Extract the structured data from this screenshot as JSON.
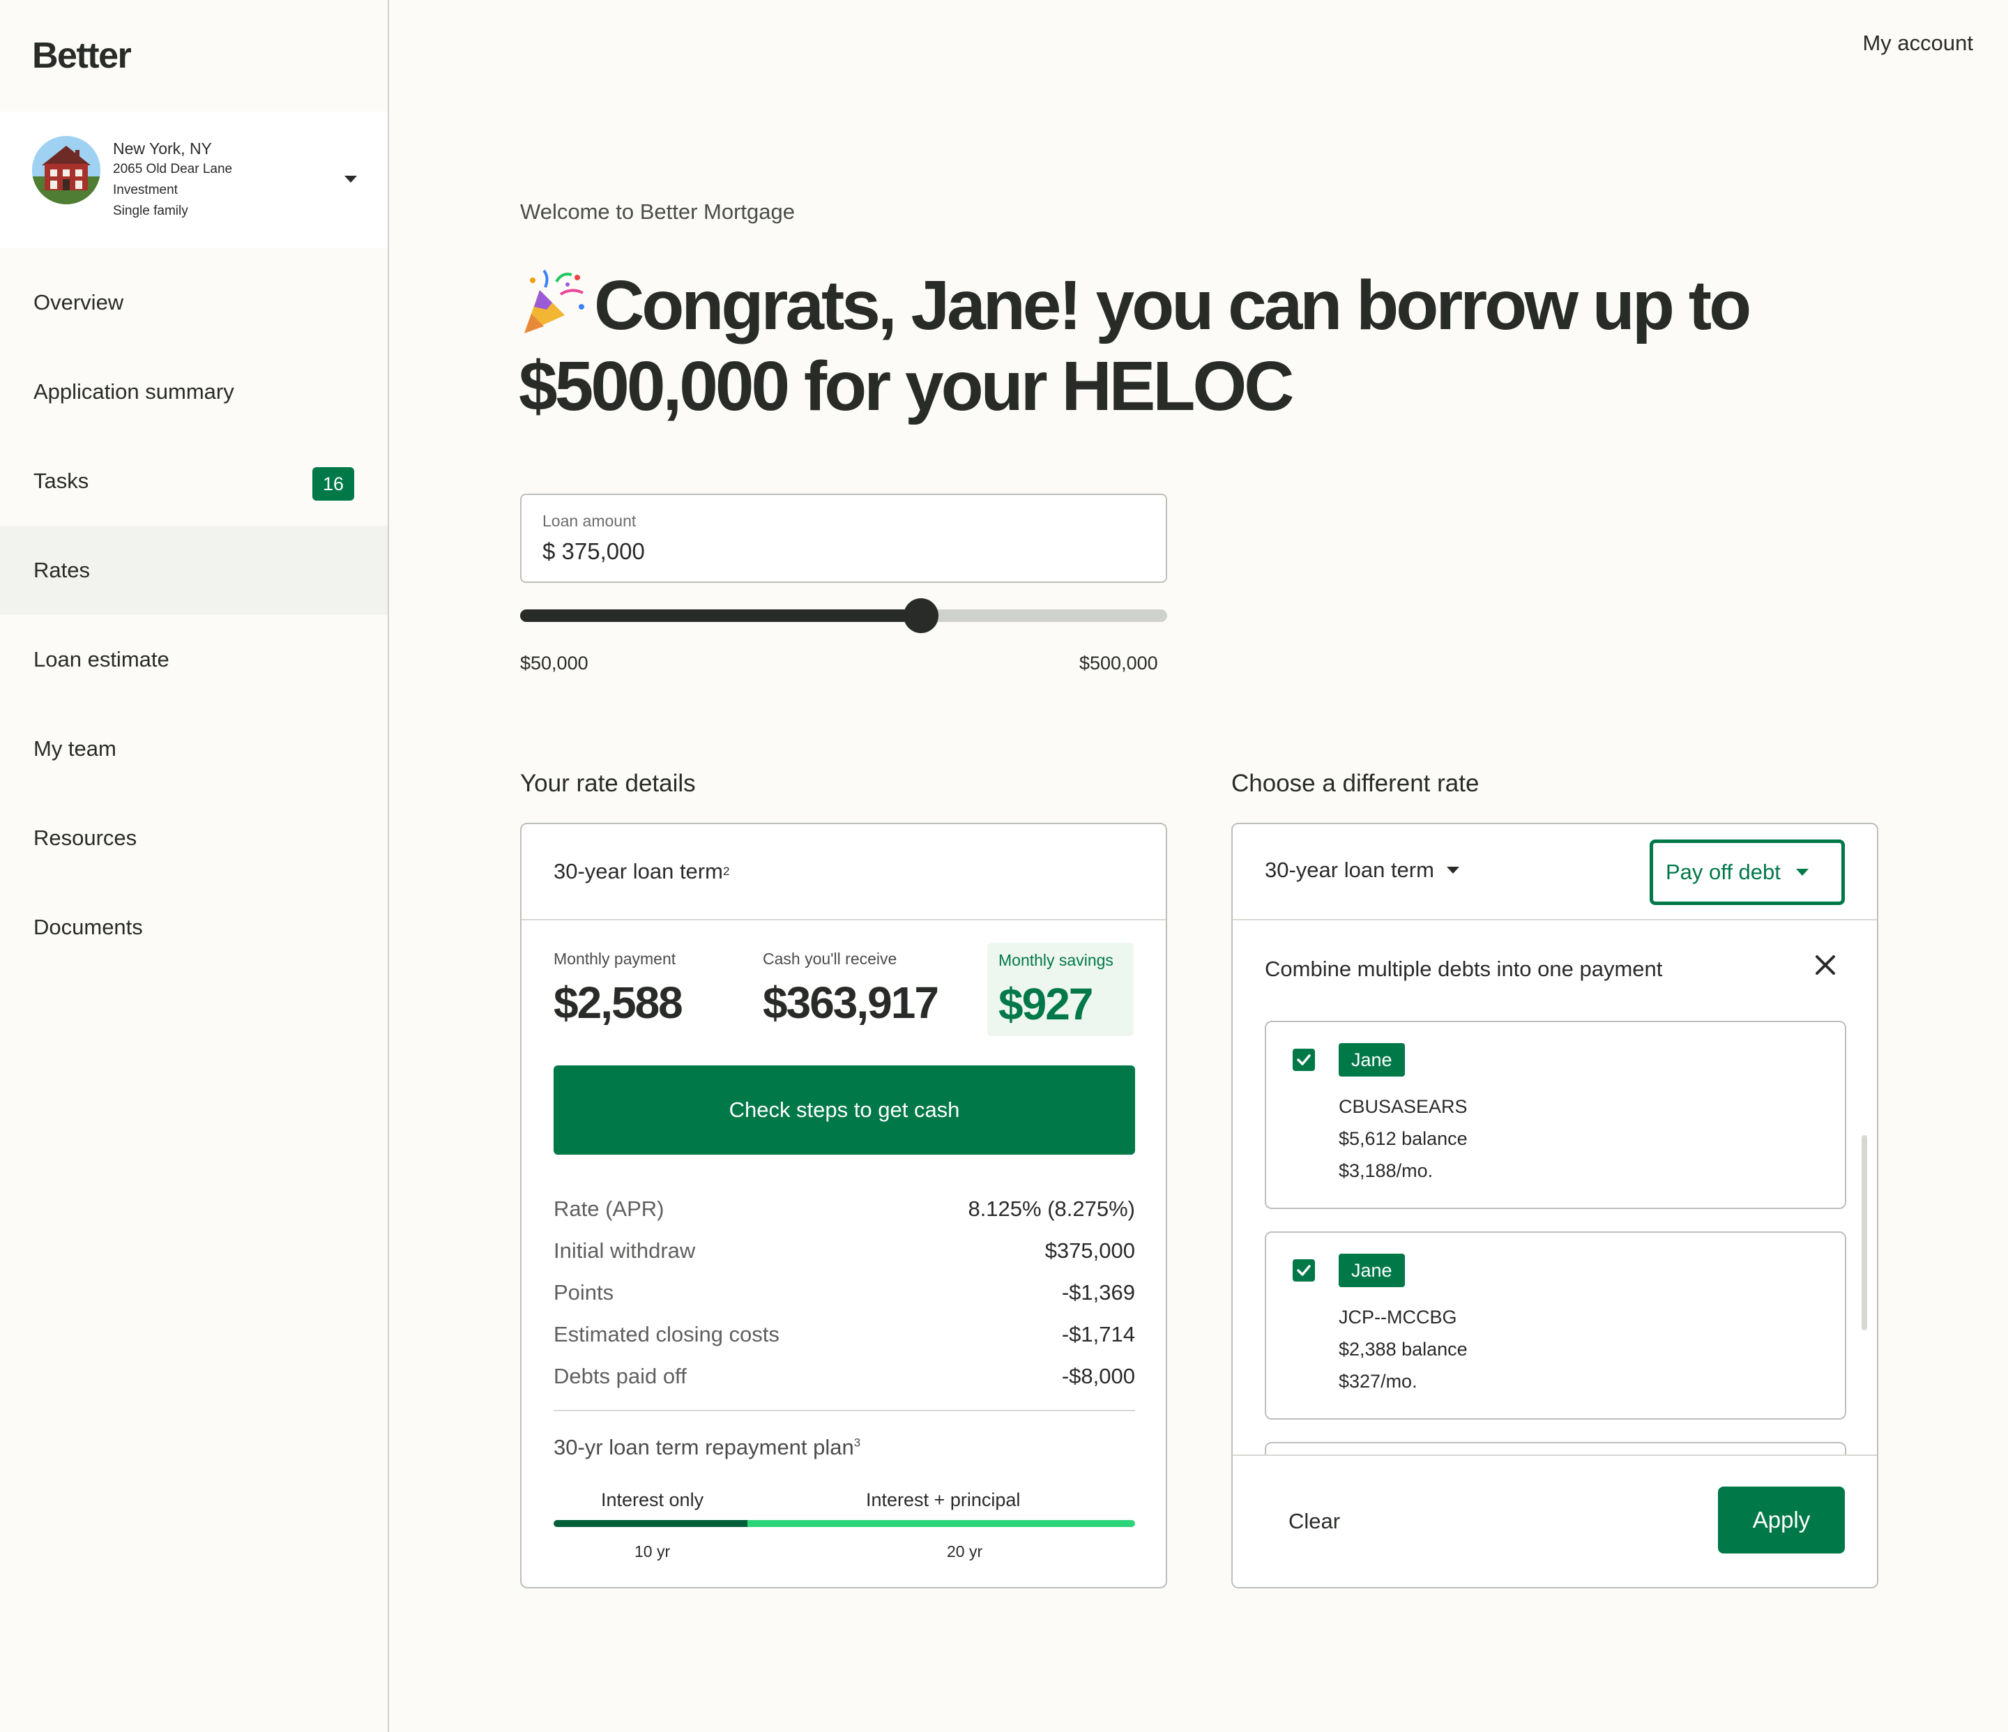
{
  "brand": {
    "logo": "Better",
    "accent": "#017848"
  },
  "header": {
    "my_account": "My account"
  },
  "property": {
    "city": "New York, NY",
    "address": "2065 Old Dear Lane",
    "use": "Investment",
    "type": "Single family"
  },
  "nav": {
    "items": [
      {
        "label": "Overview"
      },
      {
        "label": "Application summary"
      },
      {
        "label": "Tasks",
        "badge": "16"
      },
      {
        "label": "Rates",
        "active": true
      },
      {
        "label": "Loan estimate"
      },
      {
        "label": "My team"
      },
      {
        "label": "Resources"
      },
      {
        "label": "Documents"
      }
    ]
  },
  "main": {
    "welcome": "Welcome to Better Mortgage",
    "headline_line1": "Congrats, Jane!  you can borrow up to",
    "headline_line2": "$500,000 for your HELOC",
    "loan": {
      "label": "Loan amount",
      "value": "$  375,000",
      "slider_min_label": "$50,000",
      "slider_max_label": "$500,000",
      "slider_fraction": 0.62
    }
  },
  "rate_details": {
    "section_title": "Your rate details",
    "term": "30-year loan term",
    "term_sup": "2",
    "monthly_payment_label": "Monthly payment",
    "monthly_payment": "$2,588",
    "cash_label": "Cash you'll receive",
    "cash": "$363,917",
    "savings_label": "Monthly savings",
    "savings": "$927",
    "cta": "Check steps to get cash",
    "rows": [
      {
        "k": "Rate (APR)",
        "v": "8.125% (8.275%)"
      },
      {
        "k": "Initial withdraw",
        "v": "$375,000"
      },
      {
        "k": "Points",
        "v": "-$1,369"
      },
      {
        "k": "Estimated closing costs",
        "v": "-$1,714"
      },
      {
        "k": "Debts paid off",
        "v": "-$8,000"
      }
    ],
    "plan_title": "30-yr loan term repayment plan",
    "plan_sup": "3",
    "plan_phase1": "Interest only",
    "plan_phase2": "Interest + principal",
    "plan_years1": "10 yr",
    "plan_years2": "20 yr",
    "plan_phase1_fraction": 0.333
  },
  "choose_rate": {
    "section_title": "Choose a different rate",
    "term_select": "30-year loan term",
    "purpose_select": "Pay off debt",
    "combine_title": "Combine multiple debts into one payment",
    "debts": [
      {
        "owner": "Jane",
        "name": "CBUSASEARS",
        "balance": "$5,612 balance",
        "monthly": "$3,188/mo.",
        "checked": true
      },
      {
        "owner": "Jane",
        "name": "JCP--MCCBG",
        "balance": "$2,388 balance",
        "monthly": "$327/mo.",
        "checked": true
      }
    ],
    "clear": "Clear",
    "apply": "Apply"
  }
}
